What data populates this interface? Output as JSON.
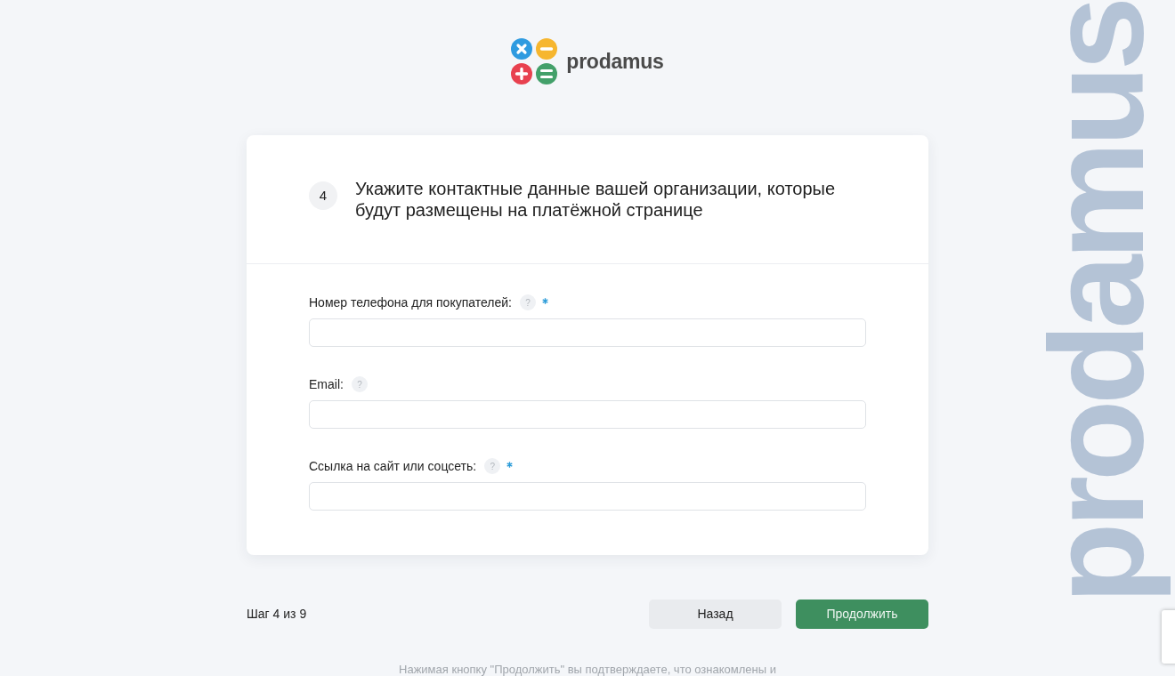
{
  "logo": {
    "text": "prodamus"
  },
  "background_wordmark": "prodamus",
  "step_card": {
    "number": "4",
    "title": "Укажите контактные данные вашей организации, которые будут размещены на платёжной странице",
    "fields": [
      {
        "label": "Номер телефона для покупателей:",
        "help": "?",
        "required": true
      },
      {
        "label": "Email:",
        "help": "?",
        "required": false
      },
      {
        "label": "Ссылка на сайт или соцсеть:",
        "help": "?",
        "required": true
      }
    ]
  },
  "footer": {
    "step_text": "Шаг 4 из 9",
    "buttons": [
      {
        "label": "Назад",
        "kind": "secondary"
      },
      {
        "label": "Продолжить",
        "kind": "primary"
      }
    ],
    "notice": "Нажимая кнопку \"Продолжить\" вы подтверждаете, что ознакомлены и"
  }
}
